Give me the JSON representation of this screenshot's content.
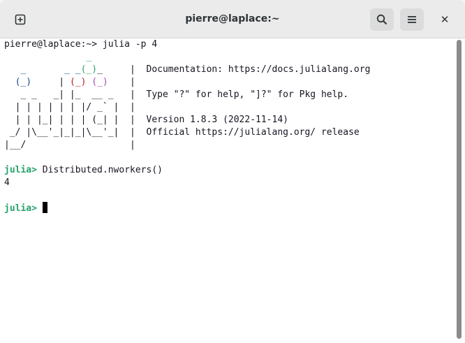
{
  "window": {
    "title": "pierre@laplace:~",
    "new_tab_icon": "new-tab-icon",
    "search_icon": "search-icon",
    "menu_icon": "hamburger-menu-icon",
    "close_label": "✕"
  },
  "terminal": {
    "command_line": "pierre@laplace:~> julia -p 4",
    "banner": {
      "row0": "               _",
      "row1_a": "   _       _ _",
      "row1_b": "(_)",
      "row1_c": "_     |  Documentation: https://docs.julialang.org",
      "row2_a": "  ",
      "row2_b": "(_)",
      "row2_c": "     | ",
      "row2_d": "(_)",
      "row2_e": " ",
      "row2_f": "(_)",
      "row2_g": "    |",
      "row3": "   _ _   _| |_  __ _   |  Type \"?\" for help, \"]?\" for Pkg help.",
      "row4": "  | | | | | | |/ _` |  |",
      "row5": "  | | |_| | | | (_| |  |  Version 1.8.3 (2022-11-14)",
      "row6": " _/ |\\__'_|_|_|\\__'_|  |  Official https://julialang.org/ release",
      "row7": "|__/                   |"
    },
    "prompt": "julia>",
    "input1": " Distributed.nworkers()",
    "output1": "4",
    "prompt2_trailing": " "
  },
  "colors": {
    "julia_green": "#26a269",
    "julia_red": "#c01c28",
    "julia_blue": "#12488b",
    "julia_purple": "#a347ba"
  }
}
